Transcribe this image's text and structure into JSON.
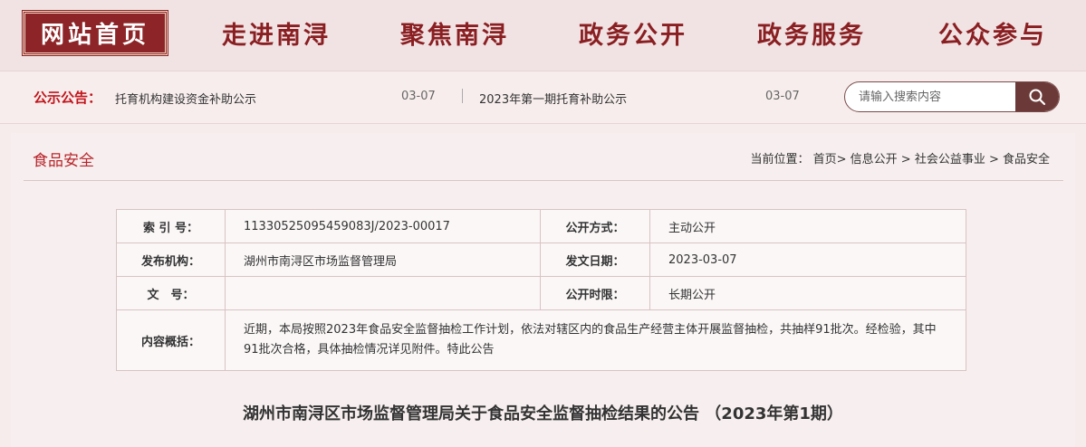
{
  "nav": {
    "home": "网站首页",
    "items": [
      "走进南浔",
      "聚焦南浔",
      "政务公开",
      "政务服务",
      "公众参与"
    ]
  },
  "notice": {
    "label": "公示公告：",
    "items": [
      {
        "text": "托育机构建设资金补助公示",
        "date": "03-07"
      },
      {
        "text": "2023年第一期托育补助公示",
        "date": "03-07"
      }
    ]
  },
  "search": {
    "placeholder": "请输入搜索内容",
    "icon": "search-icon"
  },
  "section": {
    "title": "食品安全",
    "breadcrumb": "当前位置： 首页> 信息公开 > 社会公益事业 > 食品安全"
  },
  "meta": {
    "index_label": "索 引 号：",
    "index_value": "11330525095459083J/2023-00017",
    "open_mode_label": "公开方式：",
    "open_mode_value": "主动公开",
    "publisher_label": "发布机构：",
    "publisher_value": "湖州市南浔区市场监督管理局",
    "date_label": "发文日期：",
    "date_value": "2023-03-07",
    "docno_label": "文　号：",
    "docno_value": "",
    "period_label": "公开时限：",
    "period_value": "长期公开",
    "summary_label": "内容概括：",
    "summary_value": "近期，本局按照2023年食品安全监督抽检工作计划，依法对辖区内的食品生产经营主体开展监督抽检，共抽样91批次。经检验，其中91批次合格，具体抽检情况详见附件。特此公告"
  },
  "article": {
    "title": "湖州市南浔区市场监督管理局关于食品安全监督抽检结果的公告 （2023年第1期）"
  },
  "colors": {
    "brand": "#8d2528",
    "accent_red": "#c2151b",
    "search_button": "#6b3a38"
  }
}
